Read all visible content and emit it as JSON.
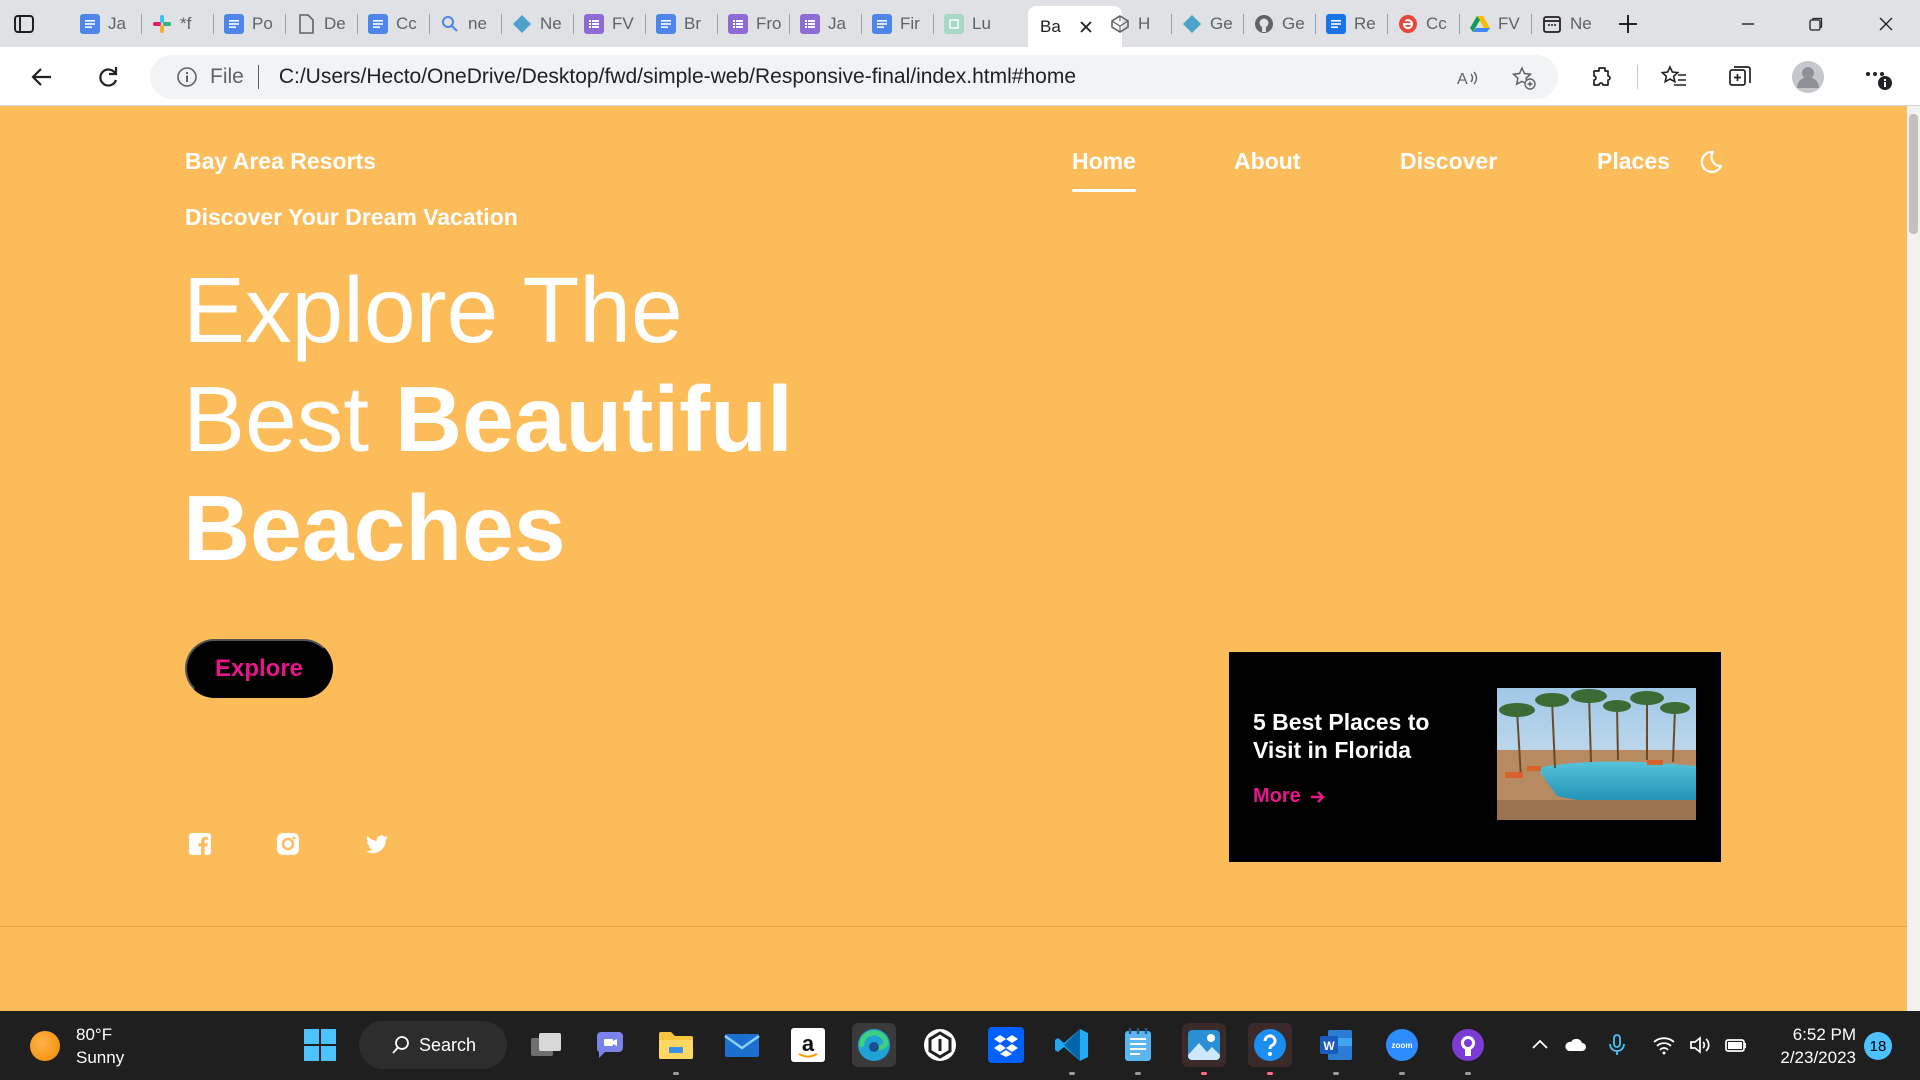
{
  "browser": {
    "tabs": [
      {
        "label": "Ja",
        "icon": "docs-icon"
      },
      {
        "label": "*f",
        "icon": "slack-icon"
      },
      {
        "label": "Po",
        "icon": "docs-icon"
      },
      {
        "label": "De",
        "icon": "file-icon"
      },
      {
        "label": "Cc",
        "icon": "docs-icon"
      },
      {
        "label": "ne",
        "icon": "search-icon"
      },
      {
        "label": "Ne",
        "icon": "diamond-icon"
      },
      {
        "label": "FV",
        "icon": "list-icon"
      },
      {
        "label": "Br",
        "icon": "docs-icon"
      },
      {
        "label": "Fro",
        "icon": "list-icon"
      },
      {
        "label": "Ja",
        "icon": "list-icon"
      },
      {
        "label": "Fir",
        "icon": "docs-icon"
      },
      {
        "label": "Lu",
        "icon": "page-icon"
      },
      {
        "label": "Ba",
        "icon": "none",
        "active": true
      },
      {
        "label": "H",
        "icon": "codepen-icon"
      },
      {
        "label": "Ge",
        "icon": "diamond-icon"
      },
      {
        "label": "Ge",
        "icon": "github-icon"
      },
      {
        "label": "Re",
        "icon": "docs-icon"
      },
      {
        "label": "Cc",
        "icon": "circle-e-icon"
      },
      {
        "label": "FV",
        "icon": "drive-icon"
      },
      {
        "label": "Ne",
        "icon": "calendar-icon"
      }
    ],
    "address": {
      "scheme_label": "File",
      "url": "C:/Users/Hecto/OneDrive/Desktop/fwd/simple-web/Responsive-final/index.html#home"
    }
  },
  "site": {
    "brand": "Bay Area Resorts",
    "nav": [
      "Home",
      "About",
      "Discover",
      "Places"
    ],
    "active_nav": "Home",
    "subtitle": "Discover Your Dream Vacation",
    "hero": {
      "line1": "Explore The",
      "line2_light": "Best ",
      "line2_bold": "Beautiful",
      "line3": "Beaches"
    },
    "explore_button": "Explore",
    "social": [
      "facebook-icon",
      "instagram-icon",
      "twitter-icon"
    ],
    "card": {
      "title": "5 Best Places to Visit in Florida",
      "more": "More"
    },
    "colors": {
      "background": "#fdbc5a",
      "accent": "#e6168b",
      "card": "#000000",
      "text": "#ffffff"
    }
  },
  "taskbar": {
    "weather": {
      "temp": "80°F",
      "condition": "Sunny"
    },
    "search_label": "Search",
    "clock": {
      "time": "6:52 PM",
      "date": "2/23/2023"
    },
    "notifications": "18"
  }
}
